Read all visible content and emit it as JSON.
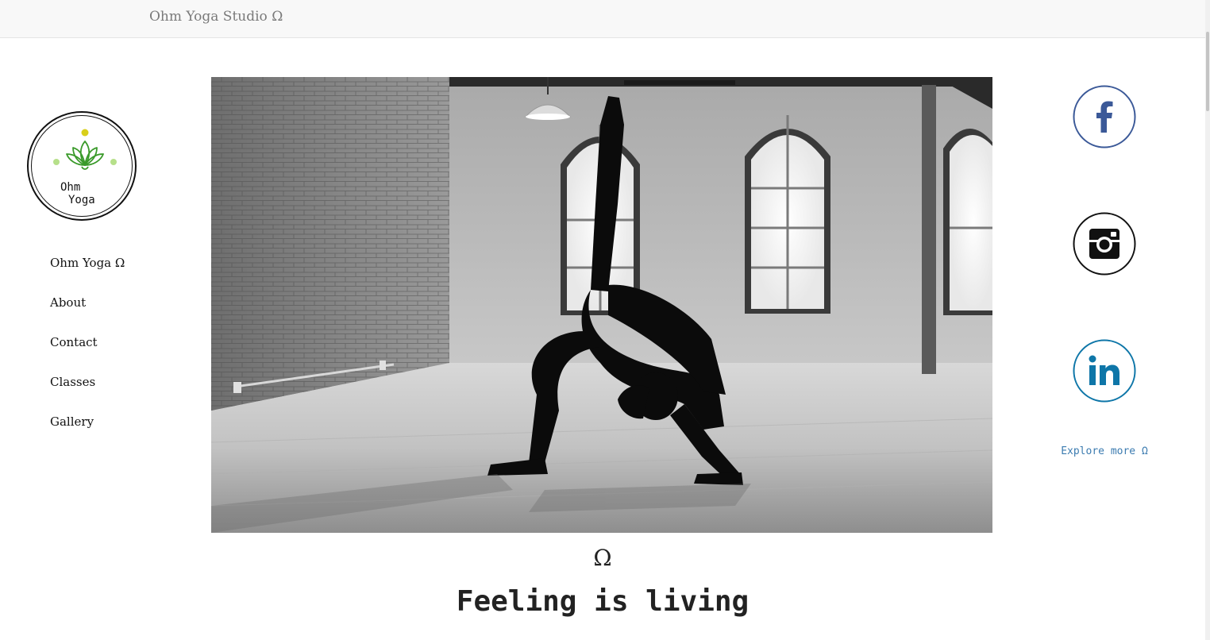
{
  "header": {
    "brand": "Ohm Yoga Studio Ω"
  },
  "logo": {
    "line1": "Ohm",
    "line2": "Yoga",
    "icon": "lotus-icon",
    "colors": {
      "leaf": "#3a9a2a",
      "dot_top": "#d9cf1a",
      "dot_side": "#b6e08a"
    }
  },
  "sidebar": {
    "items": [
      {
        "label": "Ohm Yoga Ω"
      },
      {
        "label": "About"
      },
      {
        "label": "Contact"
      },
      {
        "label": "Classes"
      },
      {
        "label": "Gallery"
      }
    ]
  },
  "hero": {
    "image": "black-and-white photo of a person in a yoga backbend pose in a studio with arched windows"
  },
  "main": {
    "symbol": "Ω",
    "headline": "Feeling is living"
  },
  "social": {
    "facebook": {
      "icon": "facebook-icon",
      "color": "#3b5998"
    },
    "instagram": {
      "icon": "instagram-icon",
      "color": "#111111"
    },
    "linkedin": {
      "icon": "linkedin-icon",
      "color": "#0e76a8"
    },
    "explore_label": "Explore more Ω"
  }
}
